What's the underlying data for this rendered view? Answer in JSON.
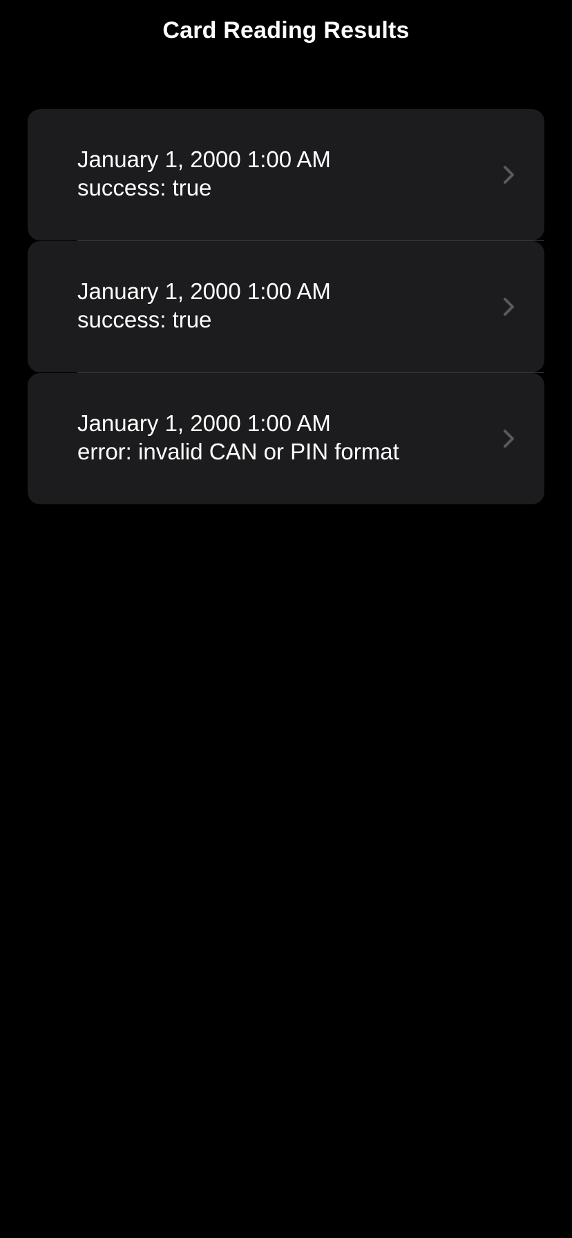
{
  "header": {
    "title": "Card Reading Results"
  },
  "results": [
    {
      "date": "January 1, 2000  1:00 AM",
      "status": "success: true"
    },
    {
      "date": "January 1, 2000  1:00 AM",
      "status": "success: true"
    },
    {
      "date": "January 1, 2000  1:00 AM",
      "status": "error: invalid CAN or PIN format"
    }
  ],
  "icons": {
    "row_disclosure": "chevron-right-icon"
  },
  "colors": {
    "background": "#000000",
    "cell_background": "#1c1c1e",
    "separator": "#3a3a3c",
    "text": "#ffffff",
    "chevron": "#5a5a5e"
  }
}
